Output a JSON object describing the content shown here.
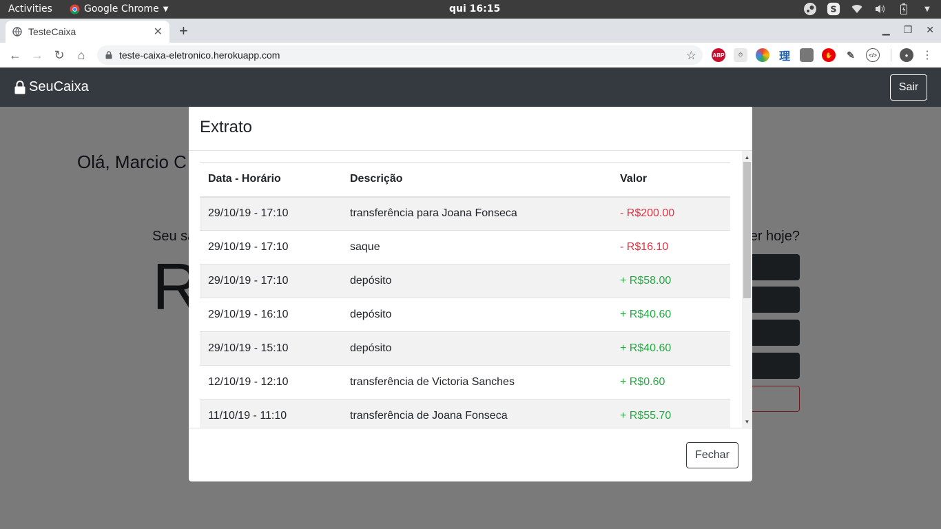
{
  "system_bar": {
    "activities": "Activities",
    "app_name": "Google Chrome",
    "clock": "qui 16:15"
  },
  "browser": {
    "tab_title": "TesteCaixa",
    "url": "teste-caixa-eletronico.herokuapp.com",
    "extensions": [
      "ABP",
      "timer",
      "color-picker",
      "理",
      "grid",
      "stop",
      "tools",
      "code"
    ]
  },
  "app": {
    "brand": "SeuCaixa",
    "logout": "Sair",
    "greeting": "Olá, Marcio C",
    "saldo_label": "Seu sa",
    "saldo_value": "R",
    "acao_label": "er hoje?"
  },
  "modal": {
    "title": "Extrato",
    "columns": [
      "Data - Horário",
      "Descrição",
      "Valor"
    ],
    "rows": [
      {
        "date": "29/10/19 - 17:10",
        "description": "transferência para Joana Fonseca",
        "value": "- R$200.00",
        "type": "neg"
      },
      {
        "date": "29/10/19 - 17:10",
        "description": "saque",
        "value": "- R$16.10",
        "type": "neg"
      },
      {
        "date": "29/10/19 - 17:10",
        "description": "depósito",
        "value": "+ R$58.00",
        "type": "pos"
      },
      {
        "date": "29/10/19 - 16:10",
        "description": "depósito",
        "value": "+ R$40.60",
        "type": "pos"
      },
      {
        "date": "29/10/19 - 15:10",
        "description": "depósito",
        "value": "+ R$40.60",
        "type": "pos"
      },
      {
        "date": "12/10/19 - 12:10",
        "description": "transferência de Victoria Sanches",
        "value": "+ R$0.60",
        "type": "pos"
      },
      {
        "date": "11/10/19 - 11:10",
        "description": "transferência de Joana Fonseca",
        "value": "+ R$55.70",
        "type": "pos"
      }
    ],
    "close_button": "Fechar"
  },
  "colors": {
    "navbar": "#343a40",
    "negative": "#dc3545",
    "positive": "#28a745"
  }
}
